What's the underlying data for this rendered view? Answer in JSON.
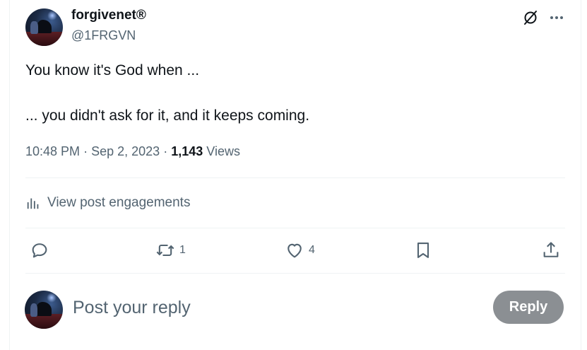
{
  "post": {
    "author": {
      "display_name": "forgivenet®",
      "handle": "@1FRGVN"
    },
    "text_lines": [
      "You know it's God when ...",
      "... you didn't ask for it, and it keeps coming."
    ],
    "meta": {
      "time": "10:48 PM",
      "date": "Sep 2, 2023",
      "views_count": "1,143",
      "views_label": "Views",
      "separator": "·"
    },
    "engagements_label": "View post engagements",
    "actions": {
      "reply_count": "",
      "repost_count": "1",
      "like_count": "4",
      "bookmark_count": ""
    }
  },
  "reply_box": {
    "placeholder": "Post your reply",
    "button_label": "Reply"
  },
  "icons": {
    "grok": "grok-icon",
    "more": "more-icon",
    "analytics": "analytics-icon",
    "reply": "reply-icon",
    "repost": "repost-icon",
    "like": "heart-icon",
    "bookmark": "bookmark-icon",
    "share": "share-icon"
  },
  "colors": {
    "text_primary": "#0f1419",
    "text_secondary": "#536471",
    "divider": "#eff3f4",
    "reply_button_disabled": "#8b8f93"
  }
}
